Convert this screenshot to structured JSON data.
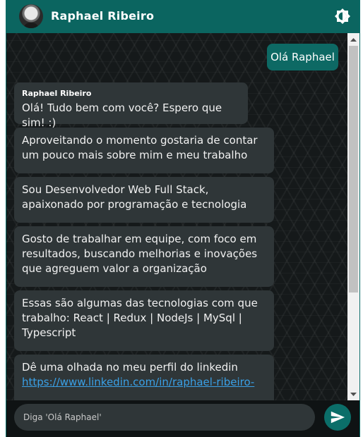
{
  "header": {
    "title": "Raphael Ribeiro"
  },
  "messages": {
    "outgoing": "Olá Raphael",
    "sender_name": "Raphael Ribeiro",
    "m1": "Olá! Tudo bem com você? Espero que sim! :)",
    "m2": "Aproveitando o momento gostaria de contar um pouco mais sobre mim e meu trabalho",
    "m3": "Sou Desenvolvedor Web Full Stack, apaixonado por programação e tecnologia",
    "m4": "Gosto de trabalhar em equipe, com foco em resultados, buscando melhorias e inovações que agreguem valor a organização",
    "m5": "Essas são algumas das tecnologias com que trabalho: React | Redux | NodeJs | MySql | Typescript",
    "m6_text": "Dê uma olhada no meu perfil do linkedin",
    "m6_link": "https://www.linkedin.com/in/raphael-ribeiro-"
  },
  "composer": {
    "placeholder": "Diga 'Olá Raphael'"
  },
  "colors": {
    "header": "#0b6560",
    "accent": "#0b6e69",
    "bubble_in": "#2f3638",
    "bubble_out": "#0d6964",
    "link": "#3aa0e6"
  }
}
